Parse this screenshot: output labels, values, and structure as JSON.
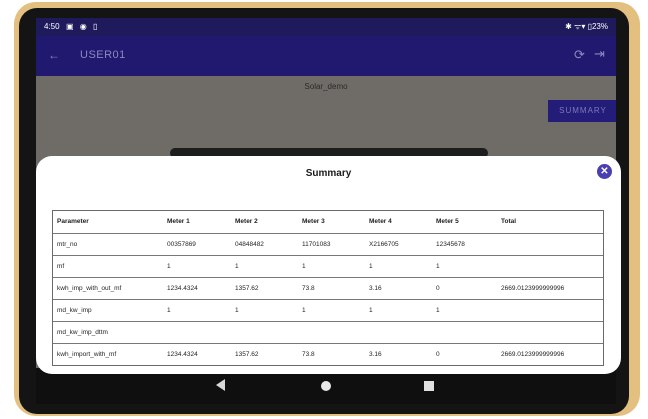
{
  "status_bar": {
    "time": "4:50",
    "icons": "▣ ◉ ▯",
    "right": "✱ ᯤ▾ ▯23%"
  },
  "app_bar": {
    "title": "USER01"
  },
  "page": {
    "subtitle": "Solar_demo",
    "summary_button": "SUMMARY"
  },
  "dialog": {
    "title": "Summary",
    "close_symbol": "✕",
    "columns": [
      "Parameter",
      "Meter 1",
      "Meter 2",
      "Meter 3",
      "Meter 4",
      "Meter 5",
      "Total"
    ],
    "rows": [
      [
        "mtr_no",
        "00357869",
        "04848482",
        "11701083",
        "X2166705",
        "12345678",
        ""
      ],
      [
        "mf",
        "1",
        "1",
        "1",
        "1",
        "1",
        ""
      ],
      [
        "kwh_imp_with_out_mf",
        "1234.4324",
        "1357.62",
        "73.8",
        "3.16",
        "0",
        "2669.0123999999996"
      ],
      [
        "md_kw_imp",
        "1",
        "1",
        "1",
        "1",
        "1",
        ""
      ],
      [
        "md_kw_imp_dttm",
        "",
        "",
        "",
        "",
        "",
        ""
      ],
      [
        "kwh_import_with_mf",
        "1234.4324",
        "1357.62",
        "73.8",
        "3.16",
        "0",
        "2669.0123999999996"
      ]
    ]
  },
  "icons": {
    "back": "arrow-left-icon",
    "refresh": "refresh-icon",
    "logout": "logout-icon",
    "close": "close-icon"
  },
  "colors": {
    "app_bar": "#21196f",
    "accent": "#4a3fb0"
  }
}
